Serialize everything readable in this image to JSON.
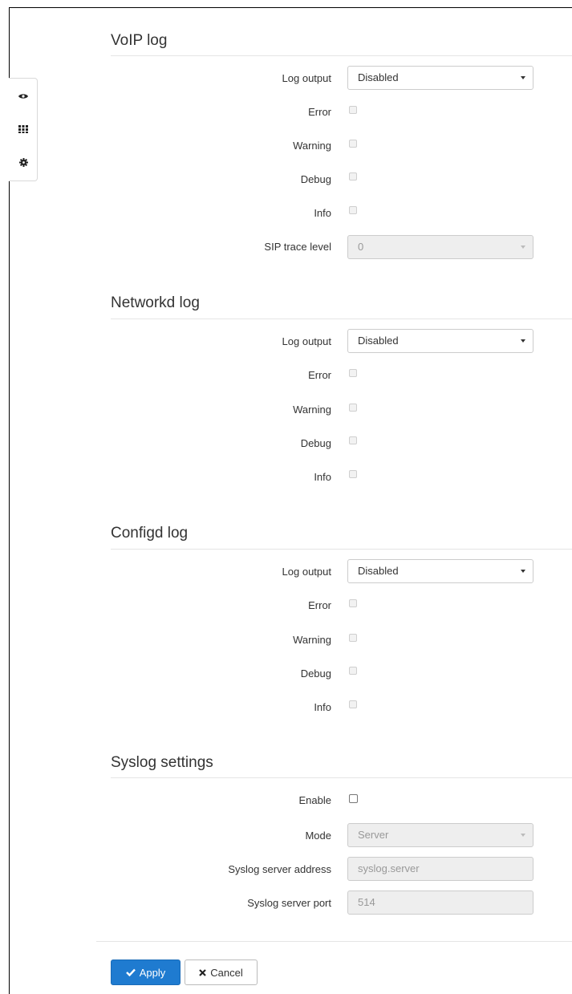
{
  "side_toolbar": {
    "icons": [
      "eye-icon",
      "grid-icon",
      "gear-icon"
    ]
  },
  "voip_log": {
    "title": "VoIP log",
    "log_output_label": "Log output",
    "log_output_value": "Disabled",
    "error_label": "Error",
    "warning_label": "Warning",
    "debug_label": "Debug",
    "info_label": "Info",
    "sip_trace_label": "SIP trace level",
    "sip_trace_value": "0"
  },
  "networkd_log": {
    "title": "Networkd log",
    "log_output_label": "Log output",
    "log_output_value": "Disabled",
    "error_label": "Error",
    "warning_label": "Warning",
    "debug_label": "Debug",
    "info_label": "Info"
  },
  "configd_log": {
    "title": "Configd log",
    "log_output_label": "Log output",
    "log_output_value": "Disabled",
    "error_label": "Error",
    "warning_label": "Warning",
    "debug_label": "Debug",
    "info_label": "Info"
  },
  "syslog_settings": {
    "title": "Syslog settings",
    "enable_label": "Enable",
    "mode_label": "Mode",
    "mode_value": "Server",
    "server_address_label": "Syslog server address",
    "server_address_placeholder": "syslog.server",
    "server_port_label": "Syslog server port",
    "server_port_placeholder": "514"
  },
  "actions": {
    "apply_label": "Apply",
    "cancel_label": "Cancel"
  },
  "colors": {
    "primary": "#1f7bd0",
    "border": "#cccccc",
    "disabled_bg": "#eeeeee"
  }
}
